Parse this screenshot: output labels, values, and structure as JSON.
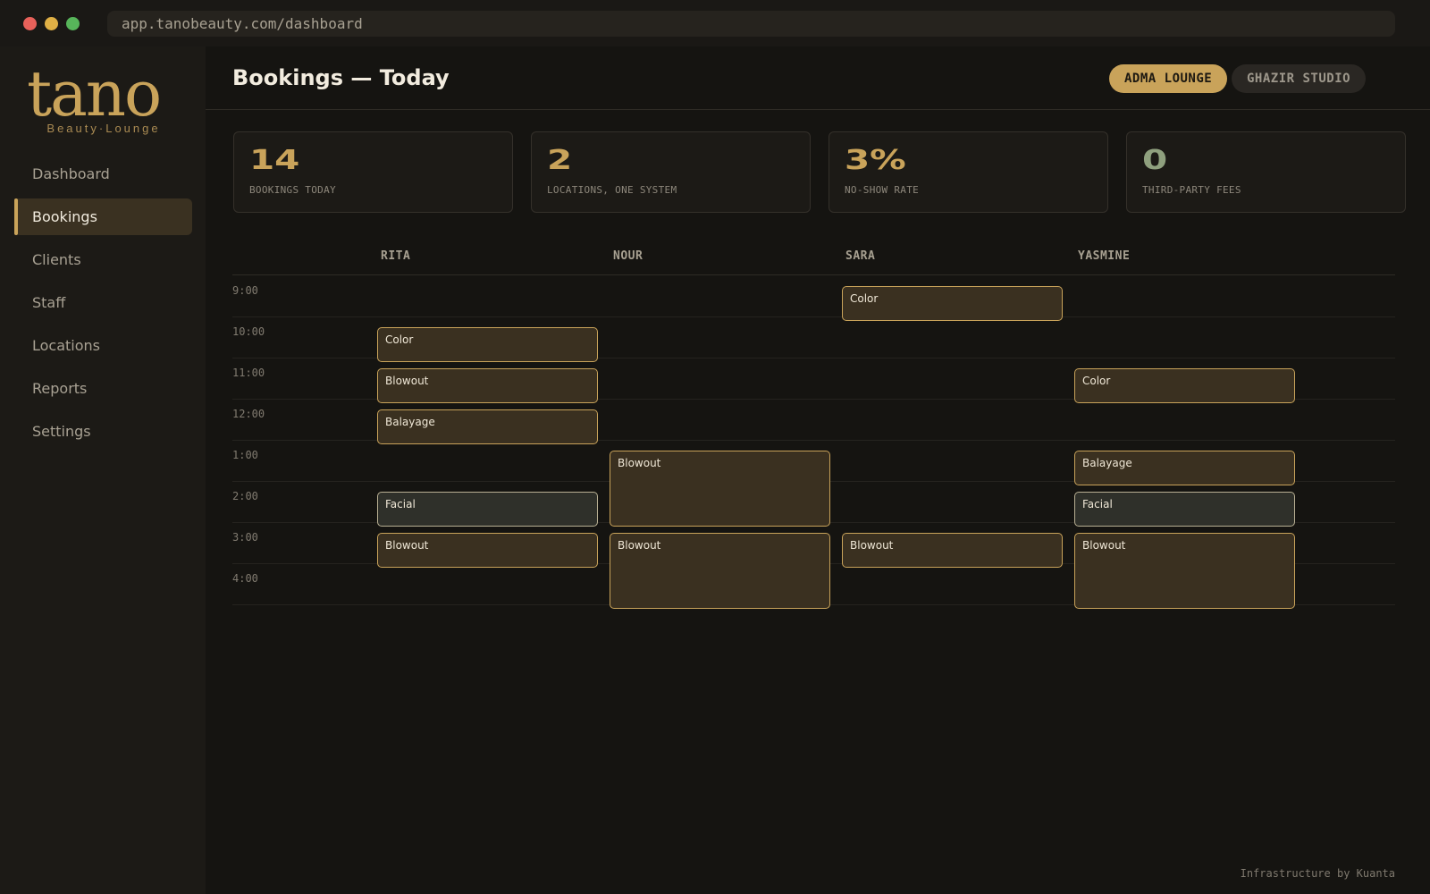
{
  "browser": {
    "url": "app.tanobeauty.com/dashboard"
  },
  "brand": {
    "logo": "tano",
    "tagline": "Beauty·Lounge",
    "accent": "#c9a35a"
  },
  "sidebar": {
    "items": [
      {
        "label": "Dashboard",
        "active": false
      },
      {
        "label": "Bookings",
        "active": true
      },
      {
        "label": "Clients",
        "active": false
      },
      {
        "label": "Staff",
        "active": false
      },
      {
        "label": "Locations",
        "active": false
      },
      {
        "label": "Reports",
        "active": false
      },
      {
        "label": "Settings",
        "active": false
      }
    ]
  },
  "header": {
    "title": "Bookings — Today",
    "locations": [
      {
        "label": "ADMA LOUNGE",
        "active": true
      },
      {
        "label": "GHAZIR STUDIO",
        "active": false
      }
    ]
  },
  "stats": [
    {
      "value": "14",
      "label": "BOOKINGS TODAY"
    },
    {
      "value": "2",
      "label": "LOCATIONS, ONE SYSTEM"
    },
    {
      "value": "3%",
      "label": "NO-SHOW RATE"
    },
    {
      "value": "0",
      "label": "THIRD-PARTY FEES"
    }
  ],
  "schedule": {
    "staff": [
      "RITA",
      "NOUR",
      "SARA",
      "YASMINE"
    ],
    "times": [
      "9:00",
      "10:00",
      "11:00",
      "12:00",
      "1:00",
      "2:00",
      "3:00",
      "4:00"
    ],
    "appointments": [
      {
        "staff": 2,
        "start": 0,
        "slots": 1,
        "service": "Color"
      },
      {
        "staff": 0,
        "start": 1,
        "slots": 1,
        "service": "Color"
      },
      {
        "staff": 0,
        "start": 2,
        "slots": 1,
        "service": "Blowout"
      },
      {
        "staff": 3,
        "start": 2,
        "slots": 1,
        "service": "Color"
      },
      {
        "staff": 0,
        "start": 3,
        "slots": 1,
        "service": "Balayage"
      },
      {
        "staff": 1,
        "start": 4,
        "slots": 2,
        "service": "Blowout"
      },
      {
        "staff": 3,
        "start": 4,
        "slots": 1,
        "service": "Balayage"
      },
      {
        "staff": 0,
        "start": 5,
        "slots": 1,
        "service": "Facial"
      },
      {
        "staff": 3,
        "start": 5,
        "slots": 1,
        "service": "Facial"
      },
      {
        "staff": 0,
        "start": 6,
        "slots": 1,
        "service": "Blowout"
      },
      {
        "staff": 1,
        "start": 6,
        "slots": 2,
        "service": "Blowout"
      },
      {
        "staff": 2,
        "start": 6,
        "slots": 1,
        "service": "Blowout"
      },
      {
        "staff": 3,
        "start": 6,
        "slots": 2,
        "service": "Blowout"
      }
    ]
  },
  "footer": {
    "credit": "Infrastructure by Kuanta"
  }
}
